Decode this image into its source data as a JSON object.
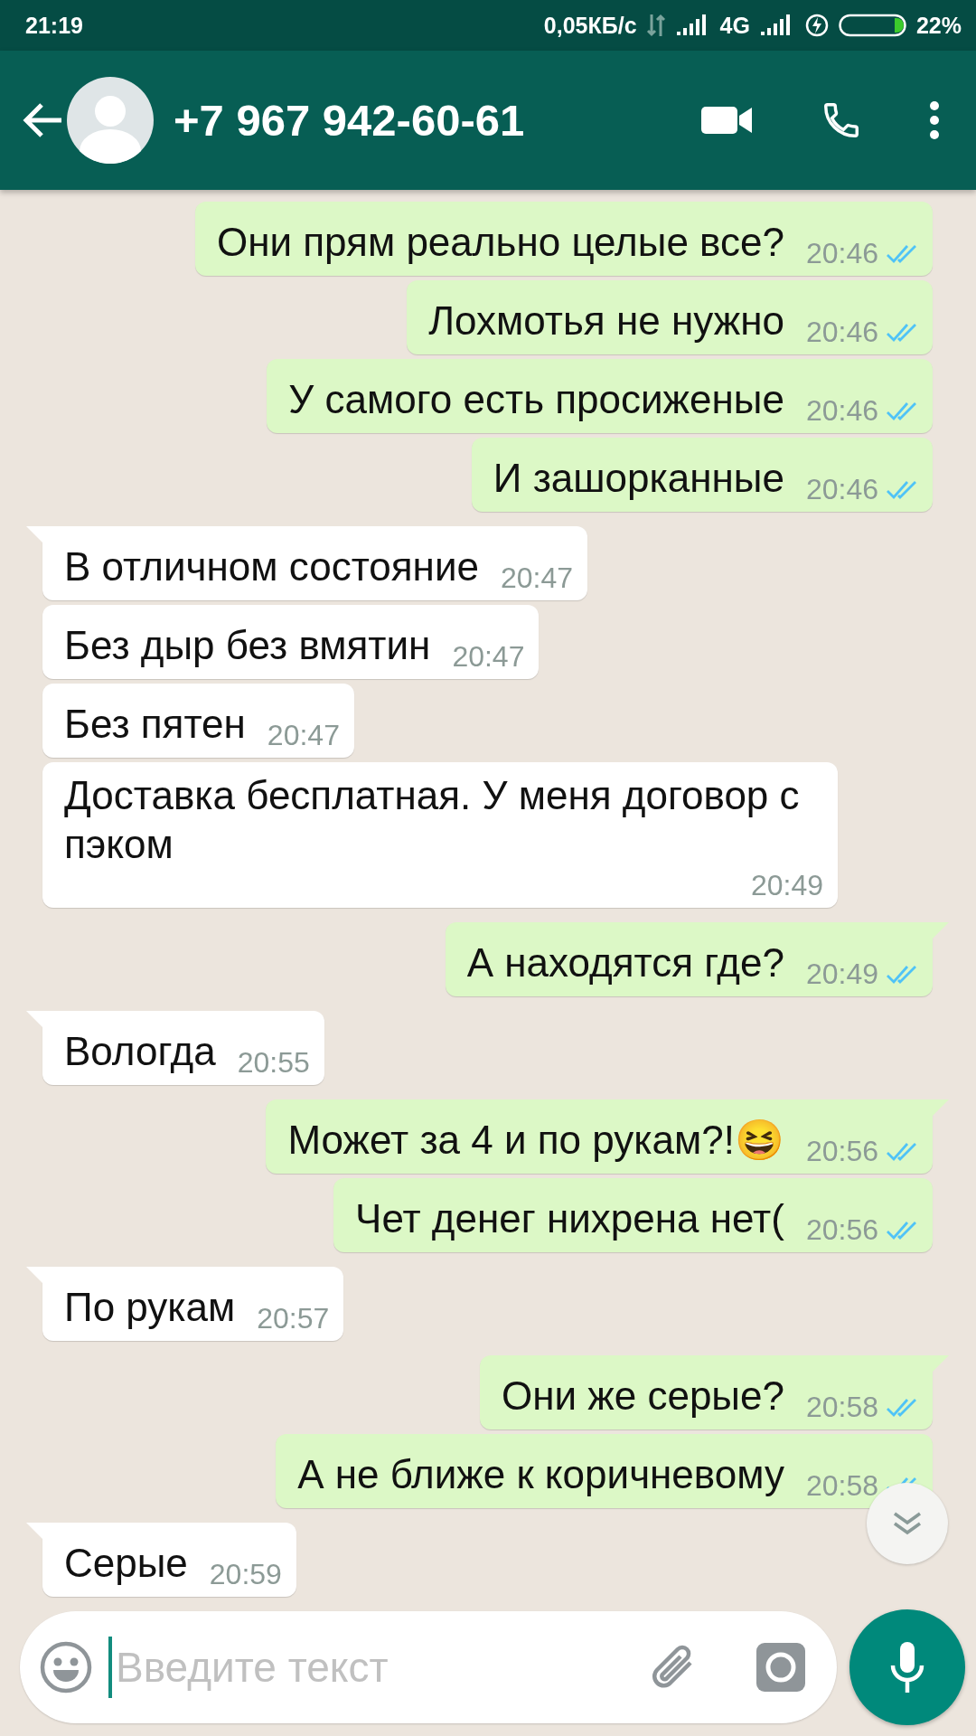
{
  "status_bar": {
    "time": "21:19",
    "network_speed": "0,05КБ/с",
    "network_type": "4G",
    "battery": "22%"
  },
  "header": {
    "title": "+7 967 942-60-61"
  },
  "messages": [
    {
      "kind": "outgoing",
      "text": "Они прям реально целые все?",
      "time": "20:46",
      "tail": false,
      "read": true
    },
    {
      "kind": "outgoing",
      "text": "Лохмотья не нужно",
      "time": "20:46",
      "tail": false,
      "read": true
    },
    {
      "kind": "outgoing",
      "text": "У самого есть просиженые",
      "time": "20:46",
      "tail": false,
      "read": true
    },
    {
      "kind": "outgoing",
      "text": "И зашорканные",
      "time": "20:46",
      "tail": false,
      "read": true
    },
    {
      "kind": "incoming",
      "text": "В отличном состояние",
      "time": "20:47",
      "tail": true
    },
    {
      "kind": "incoming",
      "text": "Без дыр без вмятин",
      "time": "20:47",
      "tail": false
    },
    {
      "kind": "incoming",
      "text": "Без пятен",
      "time": "20:47",
      "tail": false
    },
    {
      "kind": "incoming",
      "text": "Доставка бесплатная. У меня договор с пэком",
      "time": "20:49",
      "tail": false
    },
    {
      "kind": "outgoing",
      "text": "А находятся где?",
      "time": "20:49",
      "tail": true,
      "read": true
    },
    {
      "kind": "incoming",
      "text": "Вологда",
      "time": "20:55",
      "tail": true
    },
    {
      "kind": "outgoing",
      "text": "Может за 4 и по рукам?!😆",
      "time": "20:56",
      "tail": true,
      "read": true
    },
    {
      "kind": "outgoing",
      "text": "Чет денег нихрена нет(",
      "time": "20:56",
      "tail": false,
      "read": true
    },
    {
      "kind": "incoming",
      "text": "По рукам",
      "time": "20:57",
      "tail": true
    },
    {
      "kind": "outgoing",
      "text": "Они же серые?",
      "time": "20:58",
      "tail": true,
      "read": true
    },
    {
      "kind": "outgoing",
      "text": "А не ближе к коричневому",
      "time": "20:58",
      "tail": false,
      "read": true
    },
    {
      "kind": "incoming",
      "text": "Серые",
      "time": "20:59",
      "tail": true
    }
  ],
  "input": {
    "placeholder": "Введите текст"
  }
}
